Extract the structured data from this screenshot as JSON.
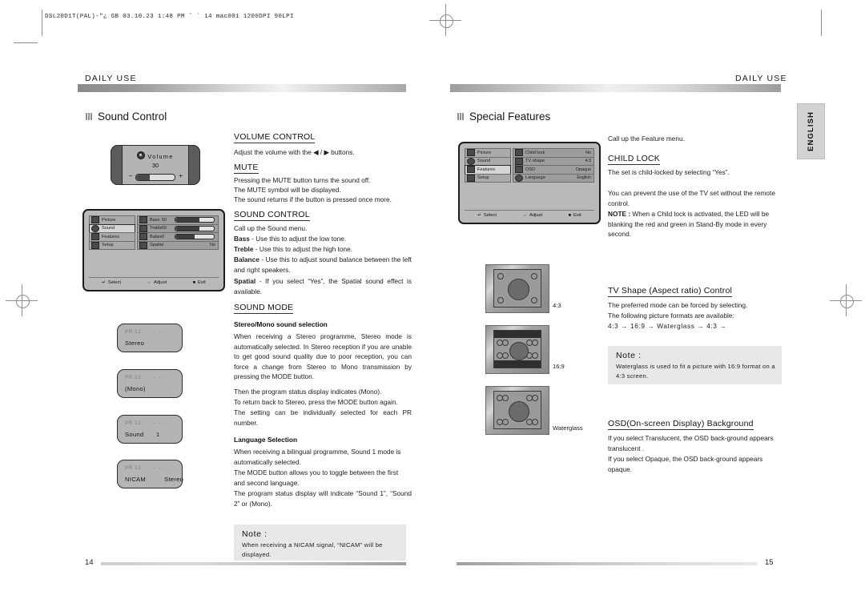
{
  "slugline": "DSL20D1T(PAL)-\"¿ GB   03.10.23 1:48 PM   ˘    ` 14    mac001  1200DPI 90LPI",
  "left_page": {
    "running_head": "DAILY USE",
    "section_title": "Sound Control",
    "folio": "14",
    "volume_osd": {
      "label": "Volume",
      "value": "30",
      "minus": "–",
      "plus": "+",
      "fill_percent": 36
    },
    "sound_menu": {
      "categories": [
        {
          "label": "Picture",
          "icon": "picture-icon",
          "selected": false
        },
        {
          "label": "Sound",
          "icon": "sound-icon",
          "selected": true
        },
        {
          "label": "Features",
          "icon": "features-icon",
          "selected": false
        },
        {
          "label": "Setup",
          "icon": "setup-icon",
          "selected": false
        }
      ],
      "items": [
        {
          "label": "Bass",
          "icon": "bass-icon",
          "value": "50",
          "bar": 62,
          "type": "bar"
        },
        {
          "label": "Treble",
          "icon": "treble-icon",
          "value": "50",
          "bar": 62,
          "type": "bar"
        },
        {
          "label": "Balance",
          "icon": "balance-icon",
          "value": "0",
          "bar": 50,
          "type": "bar"
        },
        {
          "label": "Spatial",
          "icon": "spatial-icon",
          "value": "No",
          "type": "text"
        }
      ],
      "footer": [
        {
          "glyph": "↵",
          "label": "Select"
        },
        {
          "glyph": "⇔",
          "label": "Adjust"
        },
        {
          "glyph": "■",
          "label": "Exit"
        }
      ]
    },
    "status_boxes": [
      {
        "pr": "PR 12",
        "dots": "- - - - -",
        "mode": "Stereo",
        "mode2": ""
      },
      {
        "pr": "PR 12",
        "dots": "- - - - -",
        "mode": "(Mono)",
        "mode2": ""
      },
      {
        "pr": "PR 12",
        "dots": "- - - - -",
        "mode": "Sound",
        "mode2": "1"
      },
      {
        "pr": "PR 12",
        "dots": "- - - - -",
        "mode": "NICAM",
        "mode2": "Stereo"
      }
    ],
    "volume_control": {
      "heading": "VOLUME CONTROL",
      "body": "Adjust the volume with the ◀ / ▶ buttons."
    },
    "mute": {
      "heading": "MUTE",
      "line1": "Pressing the MUTE button turns the sound off.",
      "line2": "The MUTE symbol will be displayed.",
      "line3": "The sound returns if the button is pressed once more."
    },
    "sound_control": {
      "heading": "SOUND CONTROL",
      "intro": "Call up the Sound menu.",
      "definitions": [
        {
          "term": "Bass",
          "text": " - Use this to adjust the low tone."
        },
        {
          "term": "Treble",
          "text": " - Use this to adjust the high tone."
        },
        {
          "term": "Balance",
          "text": " - Use this to adjust sound balance between the left and right speakers."
        },
        {
          "term": "Spatial",
          "text": " - If you select “Yes”, the Spatial sound effect is available."
        }
      ]
    },
    "sound_mode": {
      "heading": "SOUND MODE",
      "subheading1": "Stereo/Mono sound selection",
      "para1": "When receiving a Stereo programme, Stereo mode is automatically selected. In Stereo reception if you are unable to get good sound quality due to poor reception, you can force a change from Stereo to Mono transmission by pressing the MODE button.",
      "para2": "Then the program status display indicates (Mono).",
      "para3": "To return back to Stereo, press the MODE button again.",
      "para4": "The setting can be individually selected for each PR number.",
      "subheading2": "Language Selection",
      "para5": "When receiving a bilingual programme, Sound 1 mode is automatically selected.",
      "para6": "The MODE button allows you to toggle between the first and second language.",
      "para7": "The program status display will indicate “Sound 1”, “Sound 2” or (Mono)."
    },
    "note": {
      "title": "Note :",
      "body": "When receiving a NICAM signal, “NICAM” will be displayed."
    }
  },
  "right_page": {
    "running_head": "DAILY USE",
    "section_title": "Special Features",
    "folio": "15",
    "language_tab": "ENGLISH",
    "features_menu": {
      "categories": [
        {
          "label": "Picture",
          "icon": "picture-icon",
          "selected": false
        },
        {
          "label": "Sound",
          "icon": "sound-icon",
          "selected": false
        },
        {
          "label": "Features",
          "icon": "features-icon",
          "selected": true
        },
        {
          "label": "Setup",
          "icon": "setup-icon",
          "selected": false
        }
      ],
      "items": [
        {
          "label": "Child lock",
          "icon": "lock-icon",
          "value": "No"
        },
        {
          "label": "TV shape",
          "icon": "tv-icon",
          "value": "4:3"
        },
        {
          "label": "OSD",
          "icon": "osd-icon",
          "value": "Opaque"
        },
        {
          "label": "Language",
          "icon": "globe-icon",
          "value": "English"
        }
      ],
      "footer": [
        {
          "glyph": "↵",
          "label": "Select"
        },
        {
          "glyph": "⇔",
          "label": "Adjust"
        },
        {
          "glyph": "■",
          "label": "Exit"
        }
      ]
    },
    "intro": "Call up the Feature menu.",
    "child_lock": {
      "heading": "CHILD LOCK",
      "line1": "The set is child-locked by selecting “Yes”.",
      "line2": "You can prevent the use of the TV set without the remote control.",
      "note_label": "NOTE :",
      "note_text": " When a Child lock is activated, the LED will be blanking the red and green in Stand-By mode in every second."
    },
    "tv_shapes": [
      {
        "caption": "4:3",
        "mode": "43"
      },
      {
        "caption": "16:9",
        "mode": "169"
      },
      {
        "caption": "Waterglass",
        "mode": "water"
      }
    ],
    "tv_shape": {
      "heading": "TV Shape (Aspect ratio) Control",
      "line1": "The preferred mode can be forced by selecting.",
      "line2": "The following picture formats are available:",
      "cycle": "4:3 → 16:9 → Waterglass → 4:3 →"
    },
    "note": {
      "title": "Note :",
      "body": "Waterglass is used to fit a picture with 16:9 format on a 4:3 screen."
    },
    "osd_background": {
      "heading": "OSD(On-screen Display) Background",
      "line1": "If you select Translucent, the OSD back-ground appears translucent .",
      "line2": "If you select Opaque, the OSD back-ground appears opaque."
    }
  }
}
